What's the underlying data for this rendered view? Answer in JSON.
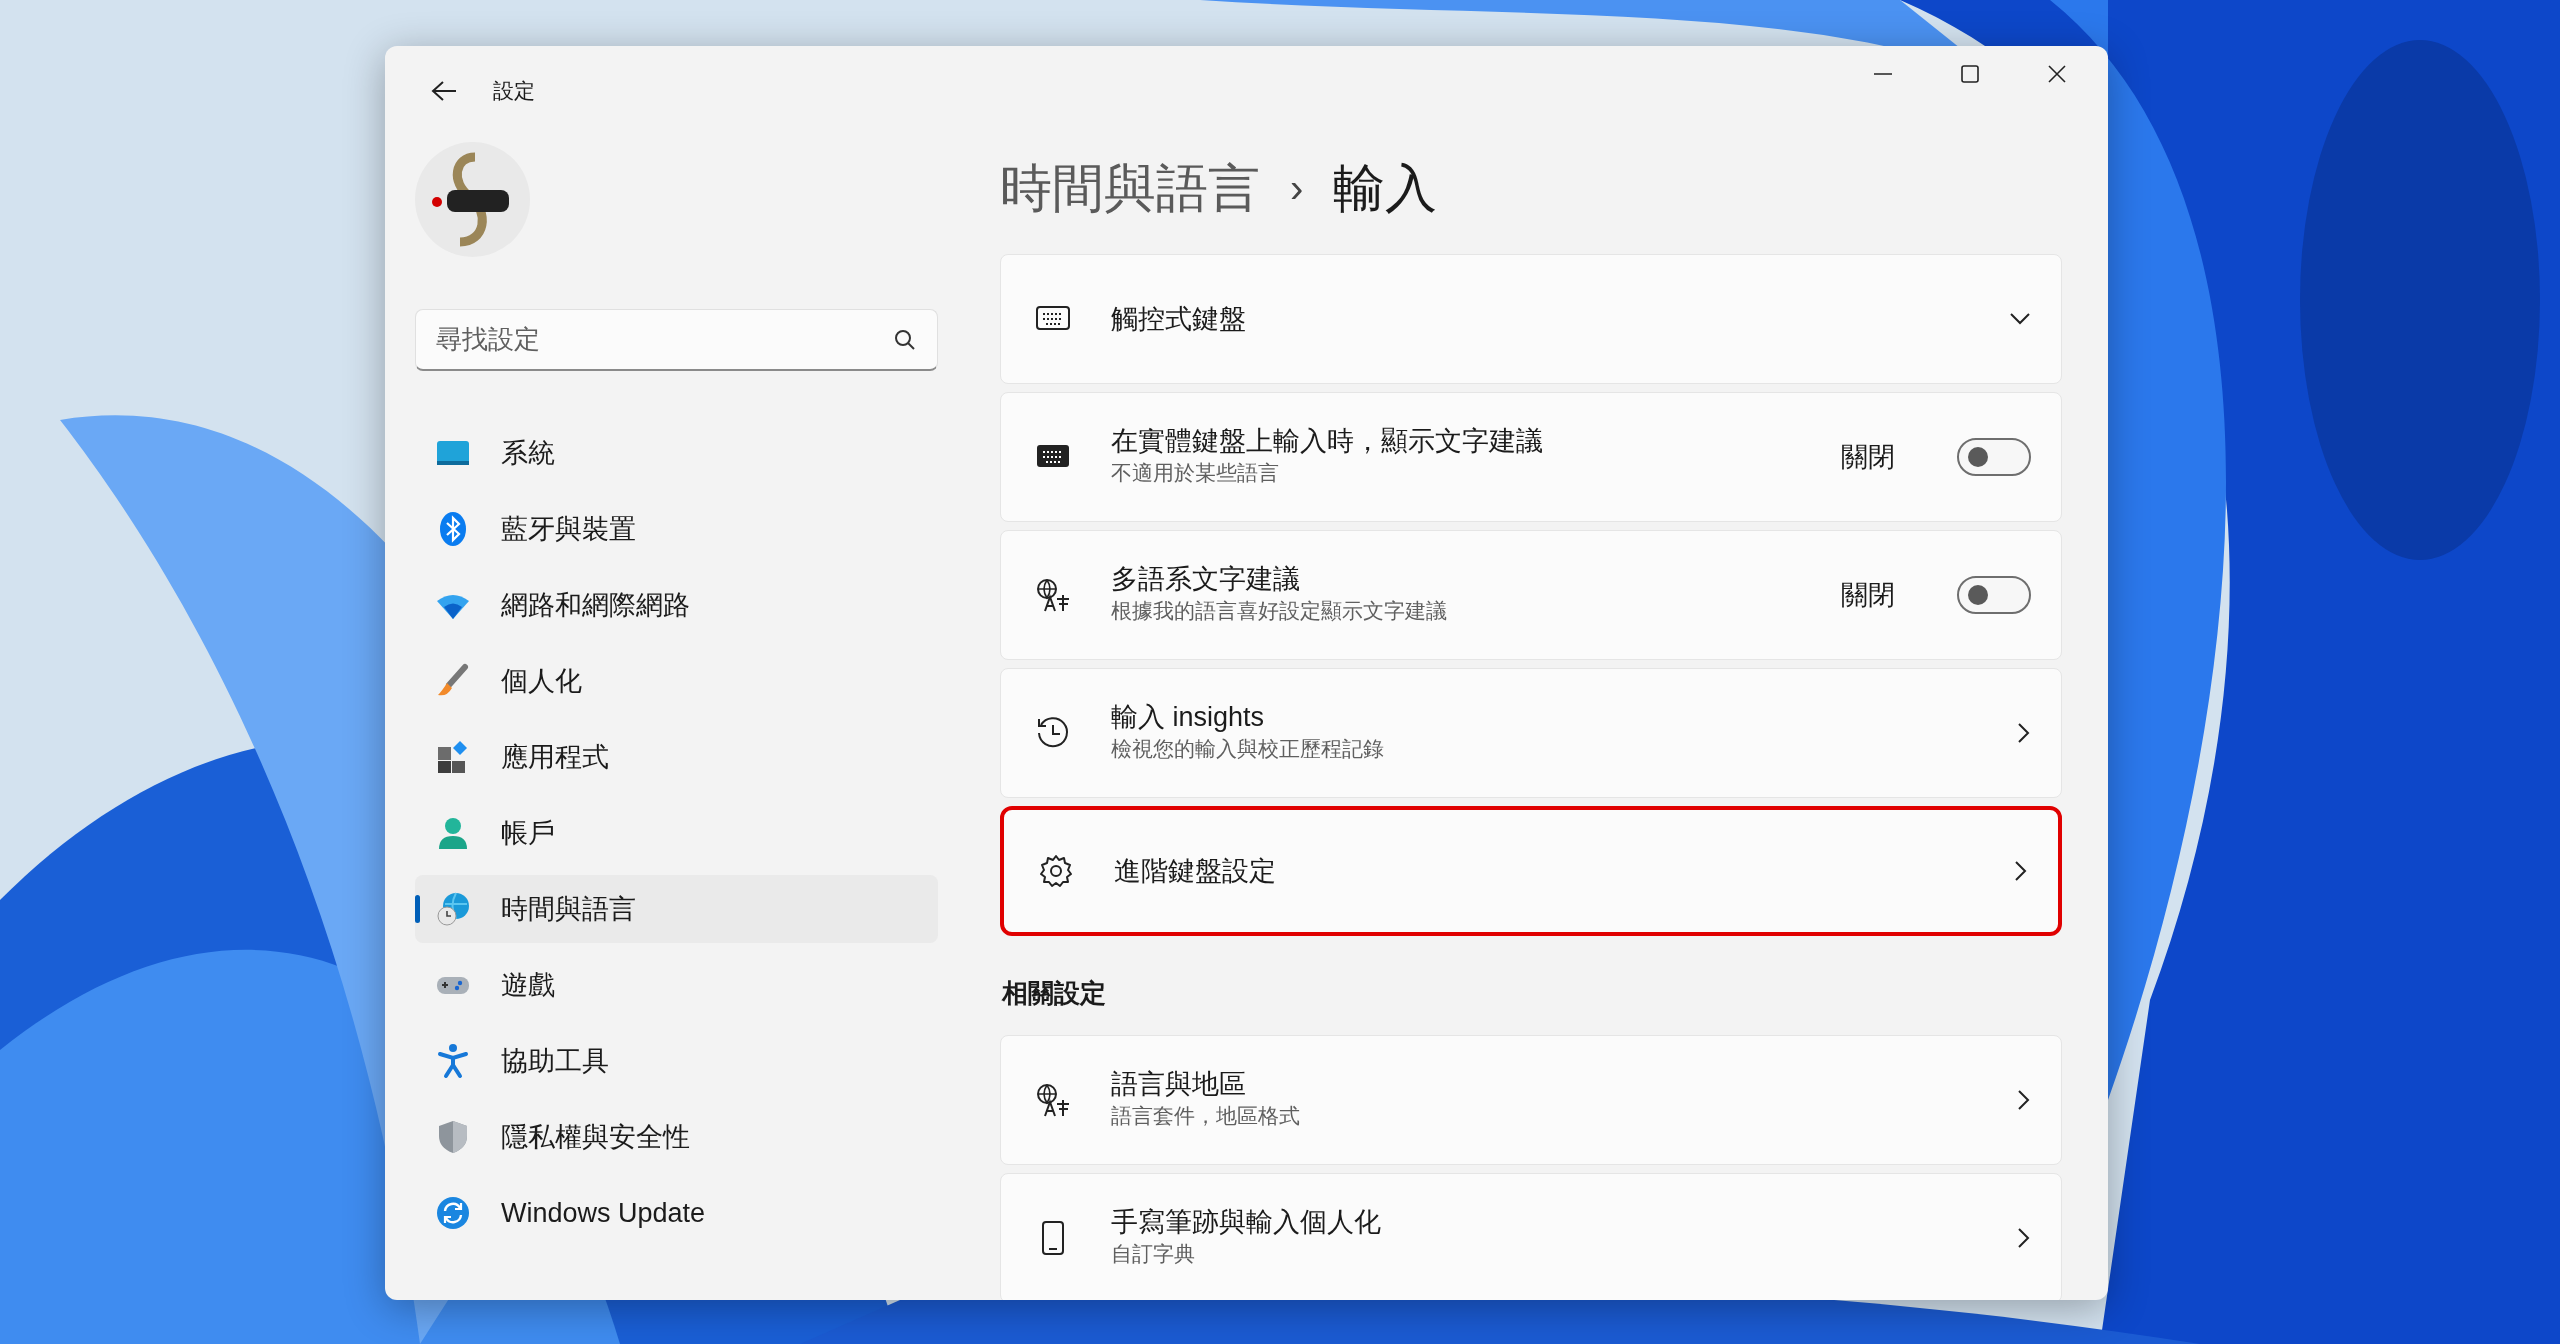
{
  "window": {
    "title": "設定"
  },
  "sidebar": {
    "search": {
      "placeholder": "尋找設定"
    },
    "items": [
      {
        "label": "系統",
        "selected": false
      },
      {
        "label": "藍牙與裝置",
        "selected": false
      },
      {
        "label": "網路和網際網路",
        "selected": false
      },
      {
        "label": "個人化",
        "selected": false
      },
      {
        "label": "應用程式",
        "selected": false
      },
      {
        "label": "帳戶",
        "selected": false
      },
      {
        "label": "時間與語言",
        "selected": true
      },
      {
        "label": "遊戲",
        "selected": false
      },
      {
        "label": "協助工具",
        "selected": false
      },
      {
        "label": "隱私權與安全性",
        "selected": false
      },
      {
        "label": "Windows Update",
        "selected": false
      }
    ]
  },
  "breadcrumb": {
    "parent": "時間與語言",
    "separator": "›",
    "current": "輸入"
  },
  "settings": [
    {
      "kind": "expander",
      "title": "觸控式鍵盤",
      "highlighted": false
    },
    {
      "kind": "toggle",
      "title": "在實體鍵盤上輸入時，顯示文字建議",
      "subtitle": "不適用於某些語言",
      "state_label": "關閉",
      "on": false,
      "highlighted": false
    },
    {
      "kind": "toggle",
      "title": "多語系文字建議",
      "subtitle": "根據我的語言喜好設定顯示文字建議",
      "state_label": "關閉",
      "on": false,
      "highlighted": false
    },
    {
      "kind": "link",
      "title": "輸入 insights",
      "subtitle": "檢視您的輸入與校正歷程記錄",
      "highlighted": false
    },
    {
      "kind": "link",
      "title": "進階鍵盤設定",
      "highlighted": true
    }
  ],
  "related": {
    "heading": "相關設定",
    "items": [
      {
        "kind": "link",
        "title": "語言與地區",
        "subtitle": "語言套件，地區格式",
        "highlighted": false
      },
      {
        "kind": "link",
        "title": "手寫筆跡與輸入個人化",
        "subtitle": "自訂字典",
        "highlighted": false
      }
    ]
  }
}
